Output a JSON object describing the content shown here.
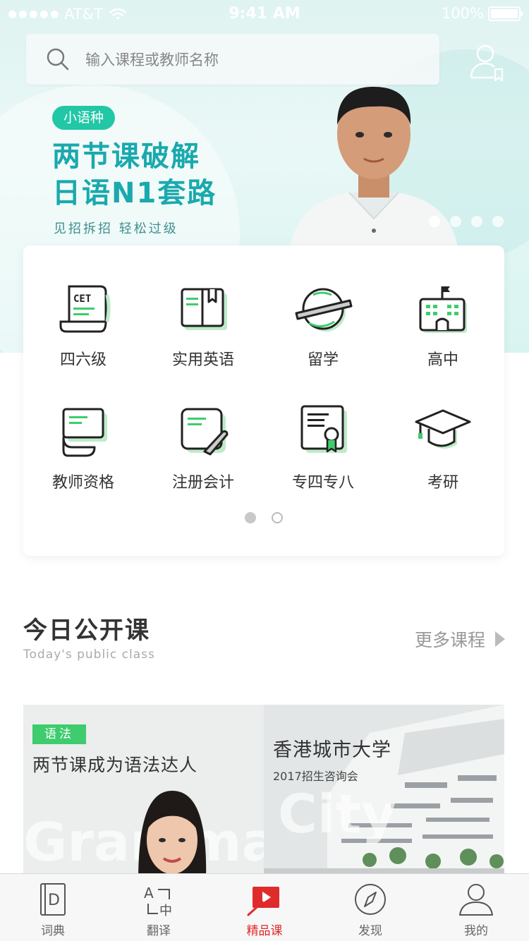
{
  "status_bar": {
    "carrier": "AT&T",
    "time": "9:41 AM",
    "battery": "100%"
  },
  "search": {
    "placeholder": "输入课程或教师名称"
  },
  "banner": {
    "tag": "小语种",
    "headline": [
      "两节课破解",
      "日语N1套路"
    ],
    "subline": "见招拆招 轻松过级",
    "page_count": 4,
    "active_page": 1
  },
  "categories": {
    "items": [
      {
        "label": "四六级",
        "icon": "cet-scroll-icon"
      },
      {
        "label": "实用英语",
        "icon": "open-book-icon"
      },
      {
        "label": "留学",
        "icon": "planet-icon"
      },
      {
        "label": "高中",
        "icon": "school-building-icon"
      },
      {
        "label": "教师资格",
        "icon": "certificate-stack-icon"
      },
      {
        "label": "注册会计",
        "icon": "notepad-pen-icon"
      },
      {
        "label": "专四专八",
        "icon": "award-certificate-icon"
      },
      {
        "label": "考研",
        "icon": "graduation-cap-icon"
      }
    ],
    "pages": 2,
    "active_page": 1
  },
  "section": {
    "title": "今日公开课",
    "subtitle": "Today's public class",
    "more": "更多课程"
  },
  "class_cards": [
    {
      "tag": "语法",
      "title": "两节课成为语法达人",
      "watermark": "Grammar"
    },
    {
      "title": "香港城市大学",
      "subtitle": "2017招生咨询会",
      "watermark": "City"
    }
  ],
  "tabbar": {
    "items": [
      {
        "label": "词典",
        "icon": "dictionary-icon",
        "active": false
      },
      {
        "label": "翻译",
        "icon": "translate-icon",
        "active": false
      },
      {
        "label": "精品课",
        "icon": "video-course-icon",
        "active": true
      },
      {
        "label": "发现",
        "icon": "compass-icon",
        "active": false
      },
      {
        "label": "我的",
        "icon": "user-icon",
        "active": false
      }
    ]
  },
  "colors": {
    "accent_green": "#3ecc6e",
    "banner_teal": "#1aa9ad",
    "tab_active_red": "#e02b2b"
  }
}
